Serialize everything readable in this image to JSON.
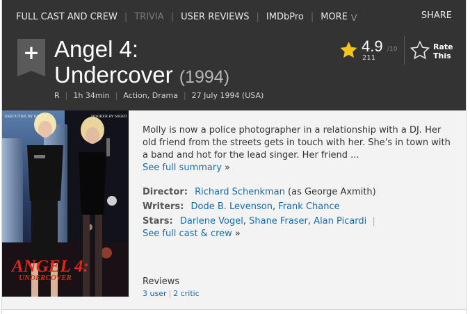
{
  "nav": {
    "items": [
      {
        "label": "FULL CAST AND CREW",
        "muted": false
      },
      {
        "label": "TRIVIA",
        "muted": true
      },
      {
        "label": "USER REVIEWS",
        "muted": false
      },
      {
        "label": "IMDbPro",
        "muted": false
      },
      {
        "label": "MORE",
        "muted": false
      }
    ],
    "share": "SHARE"
  },
  "title": {
    "line1": "Angel 4:",
    "line2": "Undercover",
    "year": "(1994)"
  },
  "subtext": {
    "certificate": "R",
    "runtime": "1h 34min",
    "genres": "Action, Drama",
    "release": "27 July 1994 (USA)"
  },
  "rating": {
    "value": "4.9",
    "out_of": "/10",
    "count": "211",
    "rate_label_1": "Rate",
    "rate_label_2": "This"
  },
  "summary": {
    "text": "Molly is now a police photographer in a relationship with a DJ. Her old friend from the streets gets in touch with her. She's in town with a band and hot for the lead singer. Her friend ...",
    "link": "See full summary",
    "arrow": "»"
  },
  "credits": {
    "director_label": "Director:",
    "director_name": "Richard Schenkman",
    "director_note": "(as George Axmith)",
    "writers_label": "Writers:",
    "writer_1": "Dode B. Levenson",
    "writer_2": "Frank Chance",
    "stars_label": "Stars:",
    "star_1": "Darlene Vogel",
    "star_2": "Shane Fraser",
    "star_3": "Alan Picardi",
    "cast_link": "See full cast & crew",
    "arrow": "»"
  },
  "reviews": {
    "heading": "Reviews",
    "user": "3 user",
    "critic": "2 critic"
  },
  "poster": {
    "title_line1": "ANGEL 4:",
    "title_line2": "UNDERCOVER",
    "tag_left": "EXECUTIVE BY DAY",
    "tag_right": "HOOKER BY NIGHT"
  },
  "colors": {
    "header_bg": "#333333",
    "link": "#136cb2",
    "star": "#f5c518"
  },
  "icons": [
    "plus-icon",
    "star-icon",
    "star-outline-icon",
    "chevron-down-icon"
  ]
}
